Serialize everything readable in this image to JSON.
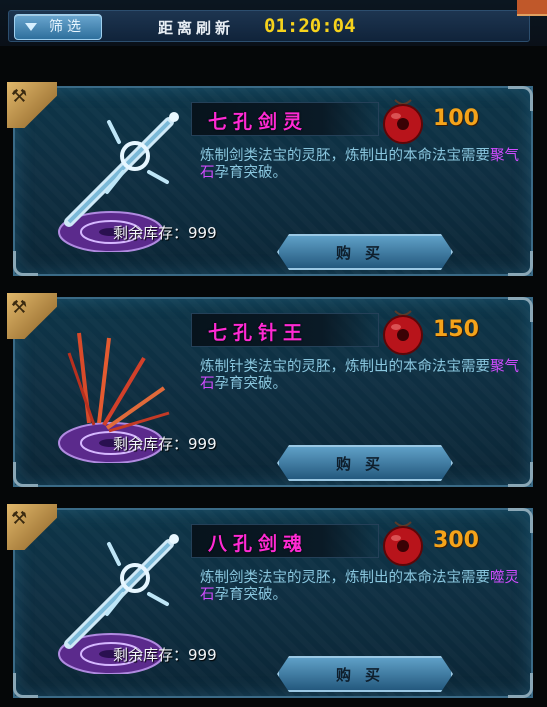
{
  "header": {
    "filter_label": "筛选",
    "refresh_label": "距离刷新",
    "refresh_time": "01:20:04"
  },
  "items": [
    {
      "name": "七孔剑灵",
      "price": "100",
      "desc_prefix": "炼制剑类法宝的灵胚，炼制出的本命法宝需要",
      "desc_highlight": "聚气石",
      "desc_suffix": "孕育突破。",
      "stock_label": "剩余库存：",
      "stock_value": "999",
      "buy_label": "购买",
      "icon": "sword-icon"
    },
    {
      "name": "七孔针王",
      "price": "150",
      "desc_prefix": "炼制针类法宝的灵胚，炼制出的本命法宝需要",
      "desc_highlight": "聚气石",
      "desc_suffix": "孕育突破。",
      "stock_label": "剩余库存：",
      "stock_value": "999",
      "buy_label": "购买",
      "icon": "needles-icon"
    },
    {
      "name": "八孔剑魂",
      "price": "300",
      "desc_prefix": "炼制剑类法宝的灵胚，炼制出的本命法宝需要",
      "desc_highlight": "噬灵石",
      "desc_suffix": "孕育突破。",
      "stock_label": "剩余库存：",
      "stock_value": "999",
      "buy_label": "购买",
      "icon": "sword-icon"
    }
  ],
  "colors": {
    "item_name": "#ff2ad4",
    "price": "#f4a31a",
    "description": "#89c6de",
    "highlight": "#d04cff",
    "timer": "#f6d21c"
  }
}
